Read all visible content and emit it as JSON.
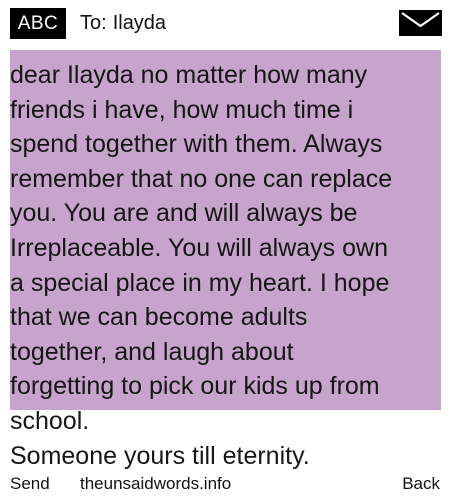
{
  "header": {
    "mode_badge": "ABC",
    "to_label": "To:",
    "recipient": "Ilayda",
    "envelope_icon": "envelope-icon"
  },
  "message": {
    "background_color": "#c7a4cc",
    "body": "dear Ilayda no matter how many\nfriends i have, how much time i\nspend together with them. Always\nremember that no one can replace\nyou. You are and will always be\nIrreplaceable. You will always own\na special place in my heart. I hope\nthat we can become adults\ntogether, and laugh about\nforgetting to pick our kids up from\nschool.\nSomeone yours till eternity."
  },
  "softkeys": {
    "left_label": "Send",
    "center_text": "theunsaidwords.info",
    "right_label": "Back"
  }
}
